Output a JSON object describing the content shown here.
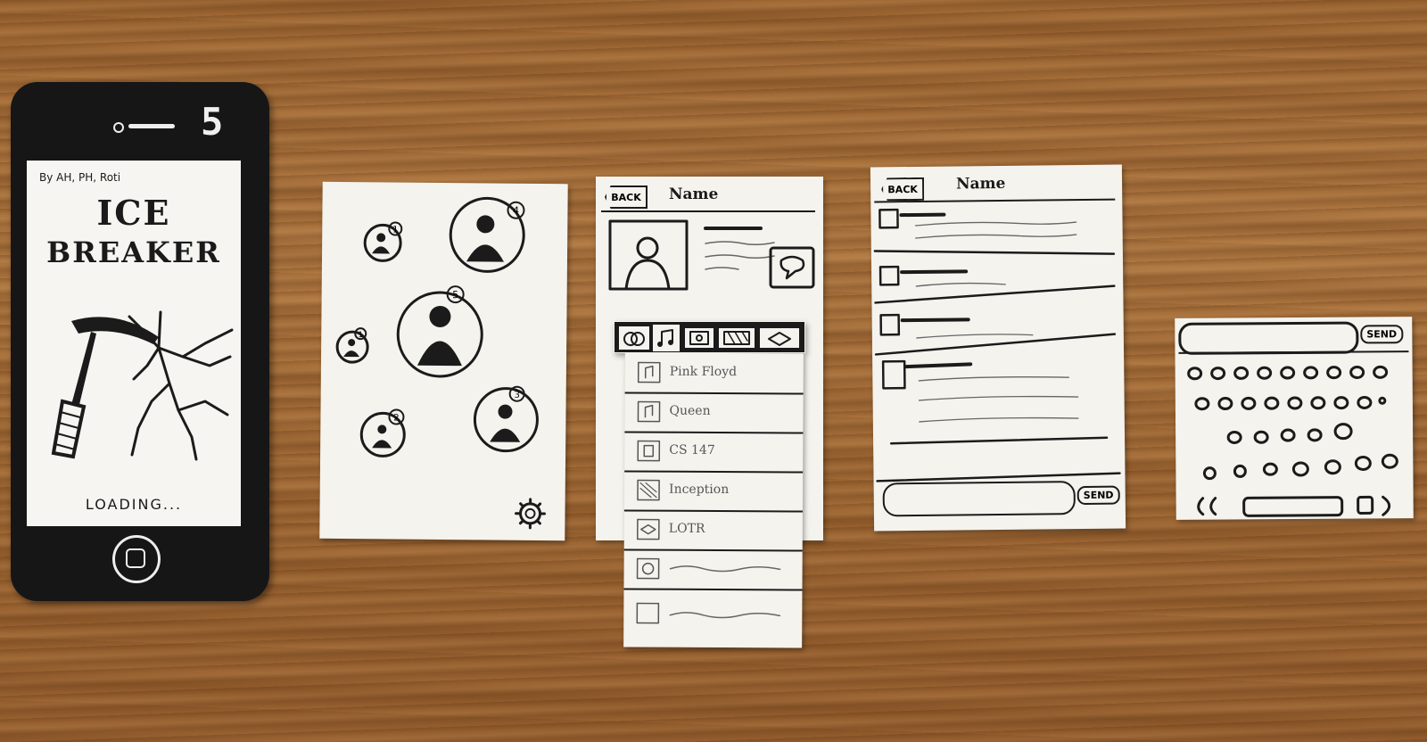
{
  "splash": {
    "credits": "By AH, PH, Roti",
    "title_line1": "ICE",
    "title_line2": "BREAKER",
    "loading": "LOADING...",
    "badge": "5"
  },
  "bubbles": {
    "items": [
      {
        "rank": "1"
      },
      {
        "rank": "4"
      },
      {
        "rank": "5"
      },
      {
        "rank": "1"
      },
      {
        "rank": "2"
      },
      {
        "rank": "3"
      }
    ],
    "settings_icon": "gear-icon"
  },
  "profile": {
    "back_label": "BACK",
    "name": "Name",
    "chat_icon": "speech-bubble-icon",
    "tabs": [
      {
        "icon": "circles-icon"
      },
      {
        "icon": "music-note-icon"
      },
      {
        "icon": "film-icon"
      },
      {
        "icon": "film-strip-icon"
      },
      {
        "icon": "book-icon"
      }
    ],
    "list": [
      {
        "icon": "music-note-icon",
        "label": "Pink Floyd"
      },
      {
        "icon": "music-note-icon",
        "label": "Queen"
      },
      {
        "icon": "book-icon",
        "label": "CS 147"
      },
      {
        "icon": "film-icon",
        "label": "Inception"
      },
      {
        "icon": "book-icon",
        "label": "LOTR"
      },
      {
        "icon": "game-icon",
        "label": ""
      },
      {
        "icon": "blank-icon",
        "label": ""
      }
    ]
  },
  "chat": {
    "back_label": "BACK",
    "name": "Name",
    "send_label": "SEND"
  },
  "keyboard": {
    "send_label": "SEND"
  }
}
